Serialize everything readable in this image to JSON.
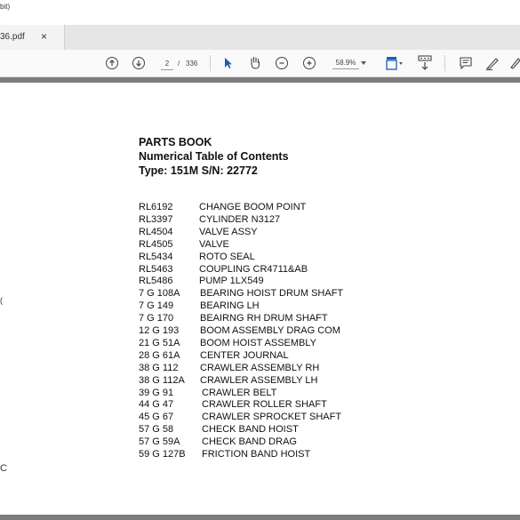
{
  "window": {
    "title_fragment": "bit)"
  },
  "tab": {
    "label": "36.pdf",
    "close_glyph": "×"
  },
  "toolbar": {
    "page_current": "2",
    "page_sep": "/",
    "page_total": "336",
    "zoom": "58.9%",
    "icons": [
      "prev-page-icon",
      "next-page-icon",
      "select-cursor-icon",
      "hand-tool-icon",
      "zoom-out-icon",
      "zoom-in-icon",
      "fit-page-icon",
      "scroll-mode-icon",
      "comment-icon",
      "highlight-icon",
      "draw-icon"
    ]
  },
  "side_marks": {
    "paren": "(",
    "c": "C"
  },
  "document": {
    "heading1": "PARTS BOOK",
    "heading2": "Numerical Table of Contents",
    "heading3": "Type: 151M  S/N: 22772",
    "rows": [
      {
        "code": "RL6192",
        "desc": "CHANGE BOOM POINT"
      },
      {
        "code": "RL3397",
        "desc": "CYLINDER N3127"
      },
      {
        "code": "RL4504",
        "desc": "VALVE ASSY"
      },
      {
        "code": "RL4505",
        "desc": "VALVE"
      },
      {
        "code": "RL5434",
        "desc": "ROTO SEAL"
      },
      {
        "code": "RL5463",
        "desc": "COUPLING CR4711&AB"
      },
      {
        "code": "RL5486",
        "desc": "PUMP 1LX549"
      },
      {
        "code": "7 G 108A",
        "desc": "BEARING HOIST DRUM SHAFT"
      },
      {
        "code": "7 G 149",
        "desc": "BEARING LH"
      },
      {
        "code": "7 G 170",
        "desc": "BEAIRNG RH DRUM SHAFT"
      },
      {
        "code": "12 G 193",
        "desc": "BOOM ASSEMBLY DRAG COM"
      },
      {
        "code": "21 G 51A",
        "desc": "BOOM HOIST ASSEMBLY"
      },
      {
        "code": "28 G 61A",
        "desc": "CENTER JOURNAL"
      },
      {
        "code": "38 G 112",
        "desc": "CRAWLER ASSEMBLY RH"
      },
      {
        "code": "38 G 112A",
        "desc": "CRAWLER ASSEMBLY LH"
      },
      {
        "code": "39 G 91",
        "desc": "CRAWLER BELT"
      },
      {
        "code": "44 G 47",
        "desc": "CRAWLER ROLLER SHAFT"
      },
      {
        "code": "45 G 67",
        "desc": "CRAWLER SPROCKET SHAFT"
      },
      {
        "code": "57 G 58",
        "desc": "CHECK BAND HOIST"
      },
      {
        "code": "57 G 59A",
        "desc": "CHECK BAND DRAG"
      },
      {
        "code": "59 G 127B",
        "desc": "FRICTION BAND HOIST"
      }
    ]
  }
}
